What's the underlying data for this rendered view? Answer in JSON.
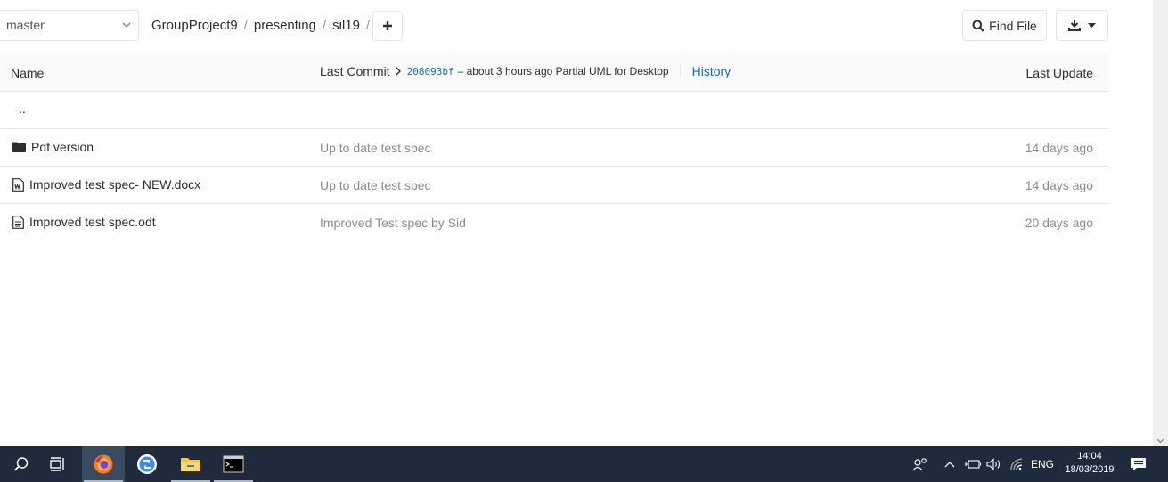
{
  "top": {
    "branch": "master",
    "breadcrumbs": [
      "GroupProject9",
      "presenting",
      "sil19"
    ],
    "add_label": "+",
    "find_file_label": "Find File"
  },
  "table": {
    "header": {
      "name": "Name",
      "last_commit": "Last Commit",
      "commit_sha": "208093bf",
      "commit_message": "– about 3 hours ago Partial UML for Desktop",
      "history": "History",
      "last_update": "Last Update"
    },
    "parent": "..",
    "rows": [
      {
        "name": "Pdf version",
        "icon": "folder-icon",
        "commit": "Up to date test spec",
        "updated": "14 days ago"
      },
      {
        "name": "Improved test spec- NEW.docx",
        "icon": "word-file-icon",
        "commit": "Up to date test spec",
        "updated": "14 days ago"
      },
      {
        "name": "Improved test spec.odt",
        "icon": "text-file-icon",
        "commit": "Improved Test spec by Sid",
        "updated": "20 days ago"
      }
    ]
  },
  "taskbar": {
    "language": "ENG",
    "time": "14:04",
    "date": "18/03/2019"
  },
  "colors": {
    "link": "#1b69b6",
    "muted": "#8c8c8c",
    "taskbar": "#1f2b3d"
  }
}
